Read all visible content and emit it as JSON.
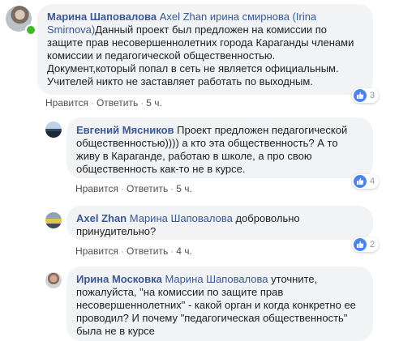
{
  "comments": [
    {
      "author": "Марина Шаповалова",
      "mentions": "Axel Zhan ирина смирнова (Irina Smirnova)",
      "text": "Данный проект был предложен на комиссии по защите прав несовершеннолетних города Караганды членами комиссии и педагогической общественностью. Документ,который попал в сеть не является официальным. Учителей никто не заставляет работать по выходным.",
      "like_label": "Нравится",
      "reply_label": "Ответить",
      "time": "5 ч.",
      "reactions": "3"
    },
    {
      "author": "Евгений Мясников",
      "mentions": "",
      "text": "Проект предложен педагогической общественностью)))) а кто эта общественность? А то живу в Караганде, работаю в школе, а про свою общественность как-то не в курсе.",
      "like_label": "Нравится",
      "reply_label": "Ответить",
      "time": "5 ч.",
      "reactions": "4"
    },
    {
      "author": "Axel Zhan",
      "mentions": "Марина Шаповалова",
      "text": "добровольно принудительно?",
      "like_label": "Нравится",
      "reply_label": "Ответить",
      "time": "4 ч.",
      "reactions": "2"
    },
    {
      "author": "Ирина Московка",
      "mentions": "Марина Шаповалова",
      "text": "уточните, пожалуйста, \"на комиссии по защите прав несовершеннолетних\" - какой орган и когда конкретно ее проводил? И почему \"педагогическая общественность\" была не в курсе"
    }
  ],
  "separator": "·",
  "icons": {
    "reaction": "like-thumb-icon",
    "avatar": "profile-photo"
  },
  "colors": {
    "author": "#385898",
    "bubble": "#f2f3f5",
    "like": "#4a84f0",
    "online": "#42b72a"
  }
}
